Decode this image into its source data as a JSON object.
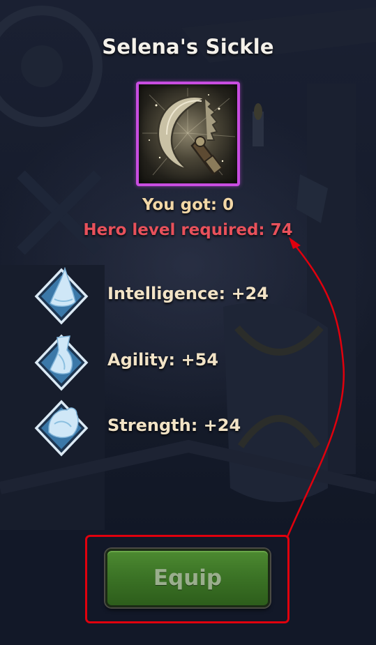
{
  "item": {
    "title": "Selena's Sickle",
    "you_got_text": "You got: 0",
    "level_required_text": "Hero level required: 74",
    "frame_color": "#c84de0"
  },
  "stats": [
    {
      "icon": "intelligence-icon",
      "text": "Intelligence: +24"
    },
    {
      "icon": "agility-icon",
      "text": "Agility: +54"
    },
    {
      "icon": "strength-icon",
      "text": "Strength: +24"
    }
  ],
  "actions": {
    "equip_label": "Equip"
  },
  "colors": {
    "title": "#f4f1ea",
    "you_got": "#f2d7a6",
    "level_required": "#e8515b",
    "button_green": "#3c7426",
    "annotation_red": "#e0000d"
  }
}
